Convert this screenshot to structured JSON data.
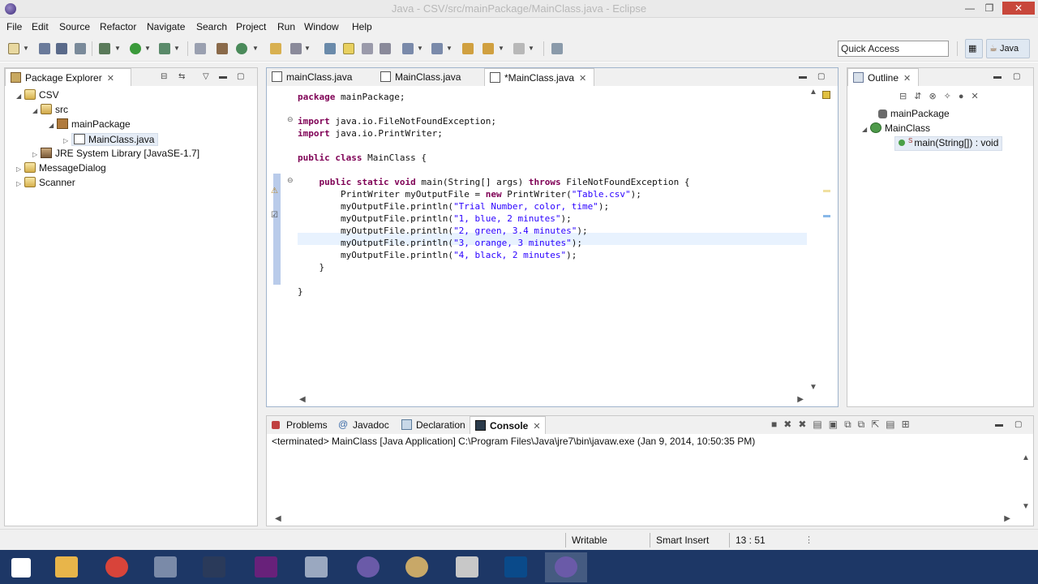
{
  "window": {
    "title": "Java - CSV/src/mainPackage/MainClass.java - Eclipse",
    "min": "—",
    "max": "❐",
    "close": "✕"
  },
  "menu": [
    "File",
    "Edit",
    "Source",
    "Refactor",
    "Navigate",
    "Search",
    "Project",
    "Run",
    "Window",
    "Help"
  ],
  "toolbar": {
    "quick_access": "Quick Access",
    "perspective": "Java"
  },
  "package_explorer": {
    "tab_label": "Package Explorer",
    "tree": [
      {
        "label": "CSV",
        "icon": "project-icon",
        "expanded": true
      },
      {
        "label": "src",
        "icon": "source-folder-icon",
        "expanded": true
      },
      {
        "label": "mainPackage",
        "icon": "package-icon",
        "expanded": true
      },
      {
        "label": "MainClass.java",
        "icon": "java-file-icon",
        "expanded": false,
        "selected": true
      },
      {
        "label": "JRE System Library [JavaSE-1.7]",
        "icon": "library-icon",
        "expanded": false
      },
      {
        "label": "MessageDialog",
        "icon": "project-icon",
        "expanded": false
      },
      {
        "label": "Scanner",
        "icon": "project-icon",
        "expanded": false
      }
    ]
  },
  "editor": {
    "tabs": [
      {
        "label": "mainClass.java",
        "active": false
      },
      {
        "label": "MainClass.java",
        "active": false
      },
      {
        "label": "*MainClass.java",
        "active": true
      }
    ],
    "lines": [
      {
        "parts": [
          {
            "t": "package",
            "c": "kw"
          },
          {
            "t": " mainPackage;"
          }
        ]
      },
      {
        "parts": []
      },
      {
        "parts": [
          {
            "t": "import",
            "c": "kw"
          },
          {
            "t": " java.io.FileNotFoundException;"
          }
        ]
      },
      {
        "parts": [
          {
            "t": "import",
            "c": "kw"
          },
          {
            "t": " java.io.PrintWriter;"
          }
        ]
      },
      {
        "parts": []
      },
      {
        "parts": [
          {
            "t": "public",
            "c": "kw"
          },
          {
            "t": " "
          },
          {
            "t": "class",
            "c": "kw"
          },
          {
            "t": " MainClass {"
          }
        ]
      },
      {
        "parts": []
      },
      {
        "parts": [
          {
            "t": "    "
          },
          {
            "t": "public",
            "c": "kw"
          },
          {
            "t": " "
          },
          {
            "t": "static",
            "c": "kw"
          },
          {
            "t": " "
          },
          {
            "t": "void",
            "c": "kw"
          },
          {
            "t": " main(String[] args) "
          },
          {
            "t": "throws",
            "c": "kw"
          },
          {
            "t": " FileNotFoundException {"
          }
        ]
      },
      {
        "parts": [
          {
            "t": "        PrintWriter myOutputFile = "
          },
          {
            "t": "new",
            "c": "kw"
          },
          {
            "t": " PrintWriter("
          },
          {
            "t": "\"Table.csv\"",
            "c": "str"
          },
          {
            "t": ");"
          }
        ]
      },
      {
        "parts": [
          {
            "t": "        myOutputFile.println("
          },
          {
            "t": "\"Trial Number, color, time\"",
            "c": "str"
          },
          {
            "t": ");"
          }
        ]
      },
      {
        "parts": [
          {
            "t": "        myOutputFile.println("
          },
          {
            "t": "\"1, blue, 2 minutes\"",
            "c": "str"
          },
          {
            "t": ");"
          }
        ]
      },
      {
        "parts": [
          {
            "t": "        myOutputFile.println("
          },
          {
            "t": "\"2, green, 3.4 minutes\"",
            "c": "str"
          },
          {
            "t": ");"
          }
        ]
      },
      {
        "parts": [
          {
            "t": "        myOutputFile.println("
          },
          {
            "t": "\"3, orange, 3 minutes\"",
            "c": "str"
          },
          {
            "t": ");"
          }
        ]
      },
      {
        "parts": [
          {
            "t": "        myOutputFile.println("
          },
          {
            "t": "\"4, black, 2 minutes\"",
            "c": "str"
          },
          {
            "t": ");"
          }
        ]
      },
      {
        "parts": [
          {
            "t": "    }"
          }
        ]
      },
      {
        "parts": []
      },
      {
        "parts": [
          {
            "t": "}"
          }
        ]
      }
    ]
  },
  "outline": {
    "tab_label": "Outline",
    "items": [
      {
        "label": "mainPackage",
        "icon": "package-decl-icon"
      },
      {
        "label": "MainClass",
        "icon": "class-icon"
      },
      {
        "label": "main(String[]) : void",
        "icon": "method-icon",
        "selected": true
      }
    ]
  },
  "bottom": {
    "tabs": [
      {
        "label": "Problems",
        "icon": "problems-icon"
      },
      {
        "label": "Javadoc",
        "icon": "javadoc-icon"
      },
      {
        "label": "Declaration",
        "icon": "declaration-icon"
      },
      {
        "label": "Console",
        "icon": "console-icon",
        "active": true
      }
    ],
    "console_text": "<terminated> MainClass [Java Application] C:\\Program Files\\Java\\jre7\\bin\\javaw.exe (Jan 9, 2014, 10:50:35 PM)"
  },
  "status": {
    "writable": "Writable",
    "insert_mode": "Smart Insert",
    "position": "13 : 51"
  },
  "taskbar": [
    {
      "name": "start-button",
      "color": "#ffffff"
    },
    {
      "name": "file-explorer",
      "color": "#e8b54a"
    },
    {
      "name": "chrome",
      "color": "#d8443a"
    },
    {
      "name": "calculator",
      "color": "#7a8aa8"
    },
    {
      "name": "steam",
      "color": "#2a3a5a"
    },
    {
      "name": "visual-studio",
      "color": "#68217a"
    },
    {
      "name": "paint-tool",
      "color": "#9aa8c0"
    },
    {
      "name": "eclipse-a",
      "color": "#6a5aa8"
    },
    {
      "name": "paint-palette",
      "color": "#c8a868"
    },
    {
      "name": "hourglass-app",
      "color": "#c8c8c8"
    },
    {
      "name": "photoshop",
      "color": "#0a4a8a"
    },
    {
      "name": "eclipse-b",
      "color": "#6a5aa8"
    }
  ]
}
